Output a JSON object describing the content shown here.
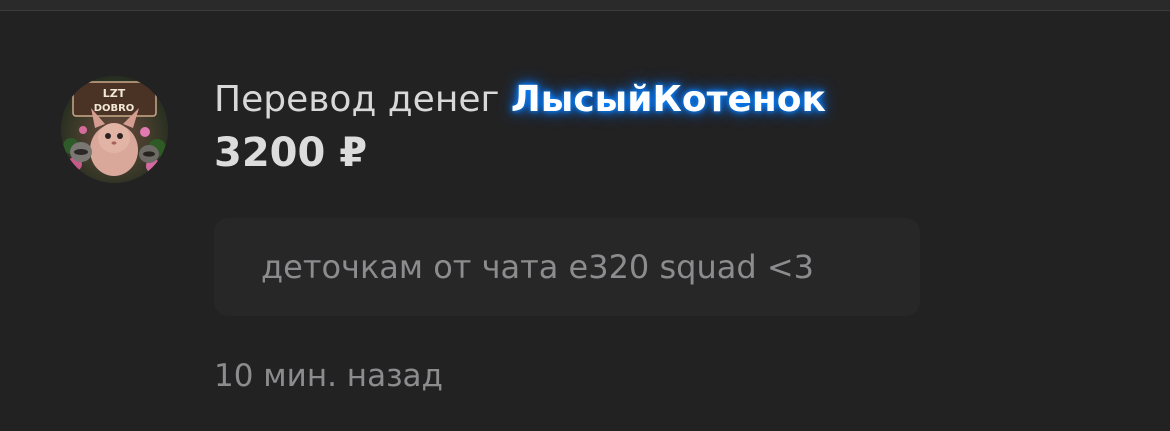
{
  "notification": {
    "title_prefix": "Перевод денег",
    "username": "ЛысыйКотенок",
    "amount": "3200 ₽",
    "comment": "деточкам от чата e320 squad <3",
    "timestamp": "10 мин. назад",
    "avatar_text_line1": "LZT",
    "avatar_text_line2": "DOBRO"
  },
  "colors": {
    "background": "#222223",
    "username_glow": "#0a84ff",
    "primary_text": "#d8d8d8",
    "secondary_text": "#8c8c8e",
    "comment_bg": "#272728"
  },
  "icons": {
    "avatar": "user-avatar-image"
  }
}
